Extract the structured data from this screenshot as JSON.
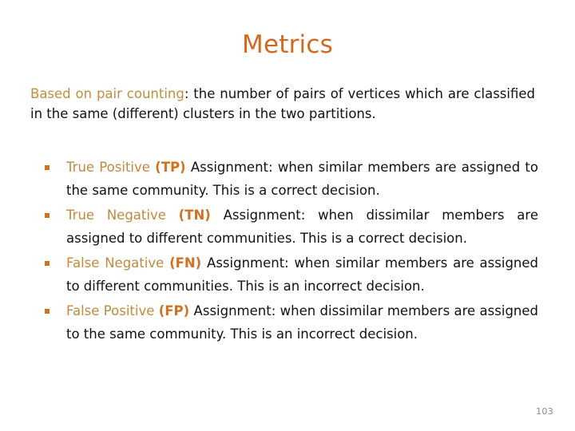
{
  "slide": {
    "title": "Metrics",
    "title_color": "#D2691E",
    "background_color": "#ffffff",
    "page_number": "103",
    "page_number_color": "#8a8a8a"
  },
  "intro": {
    "lead": "Based on pair counting",
    "lead_color": "#BF8F3F",
    "rest": ": the number of pairs of vertices which are classified in the same (different) clusters in the two partitions."
  },
  "bullets": {
    "marker_icon": "square-bullet-icon",
    "marker_color": "#D2711F",
    "term_color": "#BF8A3C",
    "abbr_color": "#D2711F",
    "items": [
      {
        "term": "True Positive ",
        "abbr": "(TP)",
        "rest": " Assignment: when similar members are assigned to the same community. This is a correct decision."
      },
      {
        "term": "True Negative ",
        "abbr": "(TN)",
        "rest": " Assignment: when dissimilar members are assigned to different communities. This is a correct decision."
      },
      {
        "term": "False Negative ",
        "abbr": "(FN)",
        "rest": " Assignment: when similar members are assigned to different communities. This is an incorrect decision."
      },
      {
        "term": "False Positive ",
        "abbr": "(FP)",
        "rest": " Assignment: when dissimilar members are assigned to the same community. This is an incorrect decision."
      }
    ]
  }
}
